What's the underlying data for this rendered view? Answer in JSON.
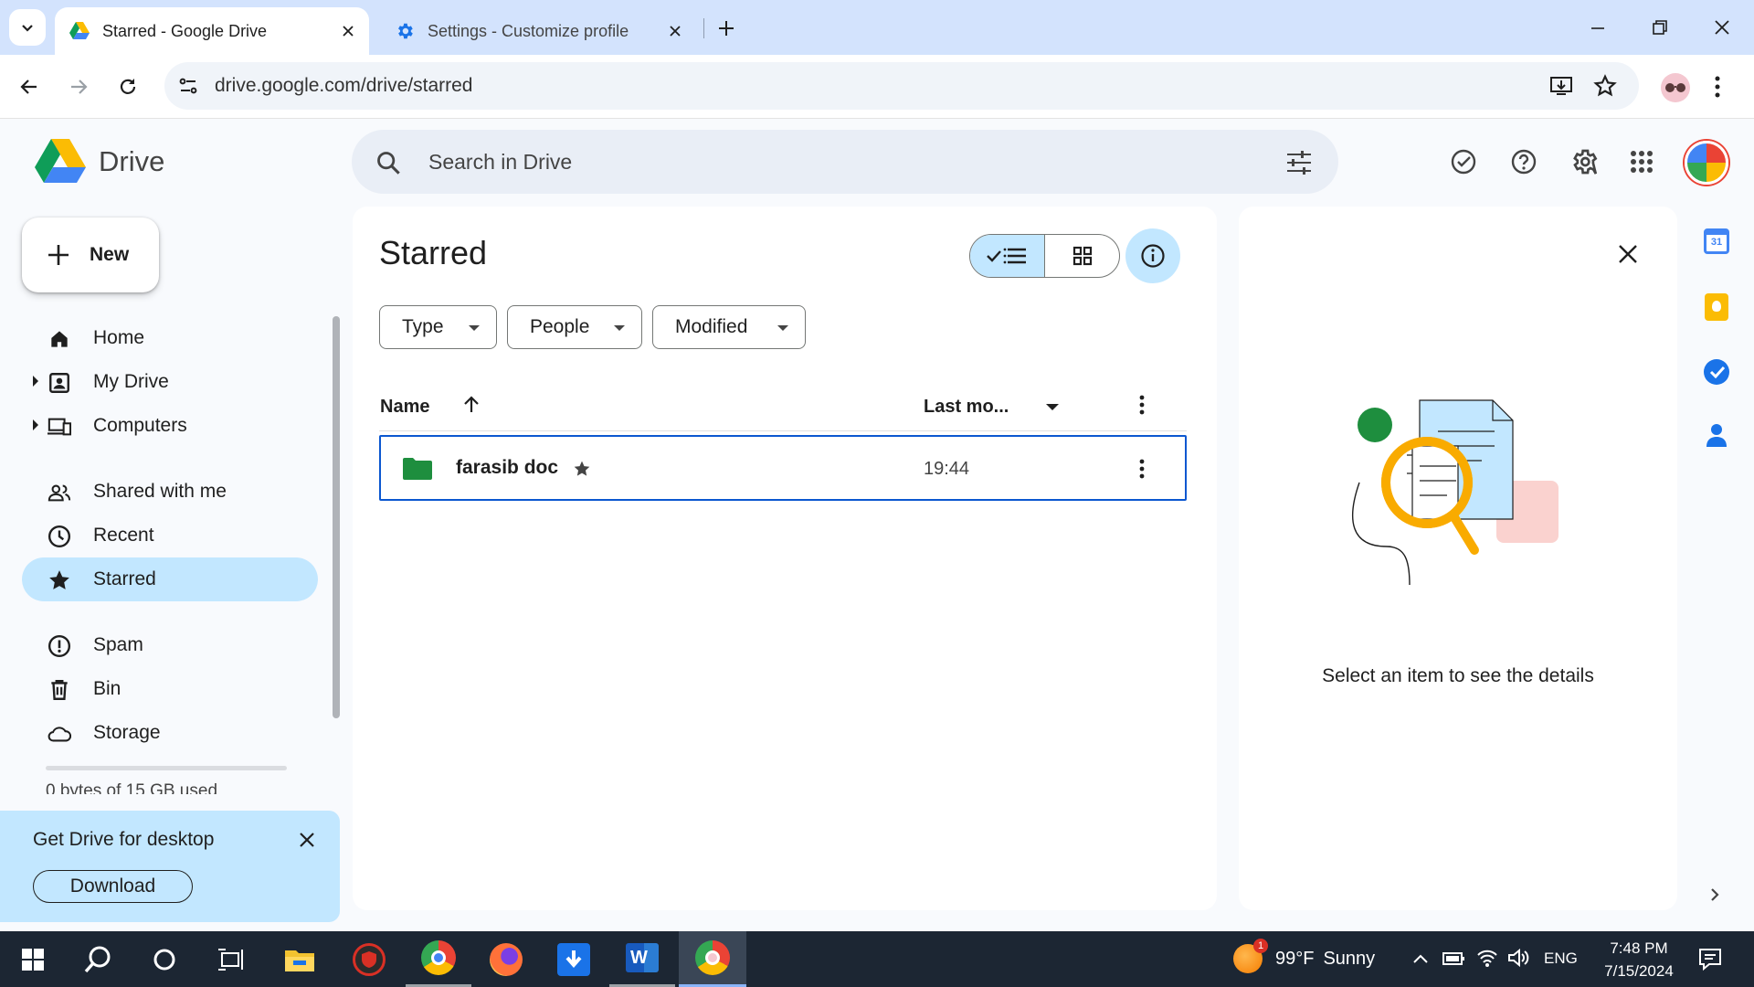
{
  "browser": {
    "tabs": [
      {
        "title": "Starred - Google Drive"
      },
      {
        "title": "Settings - Customize profile"
      }
    ],
    "url": "drive.google.com/drive/starred"
  },
  "drive": {
    "logo_text": "Drive",
    "search_placeholder": "Search in Drive",
    "new_label": "New",
    "nav": {
      "home": "Home",
      "my_drive": "My Drive",
      "computers": "Computers",
      "shared": "Shared with me",
      "recent": "Recent",
      "starred": "Starred",
      "spam": "Spam",
      "bin": "Bin",
      "storage": "Storage"
    },
    "storage_text": "0 bytes of 15 GB used",
    "promo": {
      "title": "Get Drive for desktop",
      "download_label": "Download"
    },
    "page_title": "Starred",
    "filters": {
      "type": "Type",
      "people": "People",
      "modified": "Modified"
    },
    "columns": {
      "name": "Name",
      "last_modified": "Last mo..."
    },
    "files": [
      {
        "name": "farasib doc",
        "modified": "19:44",
        "starred": true,
        "kind": "folder"
      }
    ],
    "details_message": "Select an item to see the details"
  },
  "taskbar": {
    "weather_temp": "99°F",
    "weather_text": "Sunny",
    "weather_badge": "1",
    "language": "ENG",
    "time": "7:48 PM",
    "date": "7/15/2024"
  },
  "colors": {
    "accent": "#0b57d0",
    "selected_nav": "#c2e7ff",
    "tabstrip": "#d3e3fd",
    "folder": "#1e8e3e",
    "taskbar": "#1c2633"
  }
}
